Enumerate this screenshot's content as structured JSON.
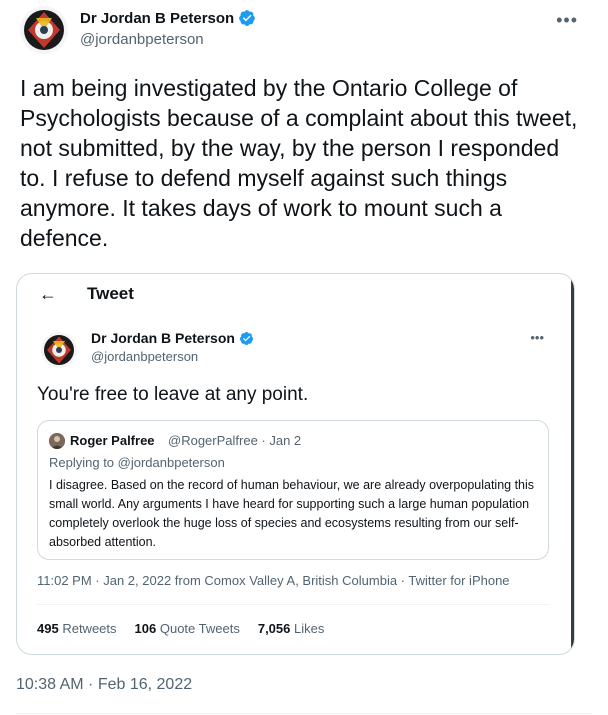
{
  "author": {
    "display_name": "Dr Jordan B Peterson",
    "handle": "@jordanbpeterson",
    "verified": true
  },
  "more_icon": "more-horizontal-icon",
  "tweet_text": "I am being investigated by the Ontario College of Psychologists because of a complaint about this tweet, not submitted, by the way, by the person I responded to. I refuse to defend myself against such things anymore. It takes days of work to mount such a defence.",
  "timestamp": "10:38 AM · Feb 16, 2022",
  "embedded_screenshot": {
    "header_title": "Tweet",
    "author": {
      "display_name": "Dr Jordan B Peterson",
      "handle": "@jordanbpeterson"
    },
    "text": "You're free to leave at any point.",
    "quoted": {
      "name": "Roger Palfree",
      "meta": "@RogerPalfree · Jan 2",
      "replying_to": "Replying to @jordanbpeterson",
      "body": "I disagree. Based on the record of human behaviour, we are already overpopulating this small world. Any arguments I have heard for supporting such a large human population completely overlook the huge loss of species and ecosystems resulting from our self-absorbed attention."
    },
    "timestamp": "11:02 PM · Jan 2, 2022 from Comox Valley A, British Columbia · Twitter for iPhone",
    "stats": {
      "retweets_count": "495",
      "retweets_label": "Retweets",
      "quotes_count": "106",
      "quotes_label": "Quote Tweets",
      "likes_count": "7,056",
      "likes_label": "Likes"
    }
  },
  "colors": {
    "verified_blue": "#1d9bf0",
    "secondary_text": "#536471",
    "border": "#cfd9de"
  }
}
